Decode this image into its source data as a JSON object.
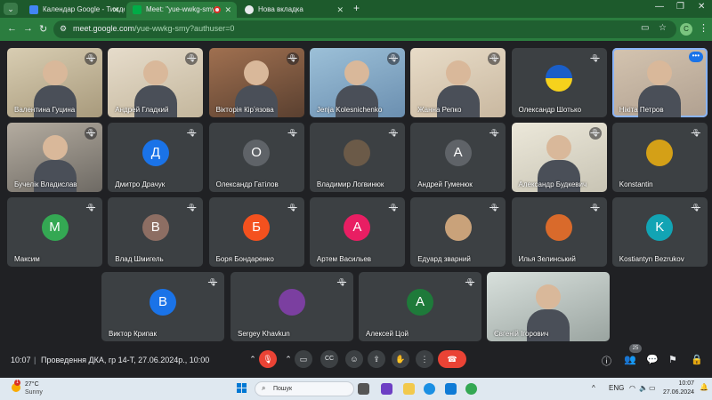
{
  "browser": {
    "tabs": [
      {
        "label": "Календар Google - Тиждень (2",
        "active": false
      },
      {
        "label": "Meet: \"yue-wwkg-smy\"",
        "active": true
      },
      {
        "label": "Нова вкладка",
        "active": false
      }
    ],
    "url_host": "meet.google.com",
    "url_path": "/yue-wwkg-smy?authuser=0",
    "profile_initial": "C"
  },
  "participants": [
    {
      "name": "Валентина Гуцина",
      "type": "video",
      "mic": "muted"
    },
    {
      "name": "Андрей Гладкий",
      "type": "video",
      "mic": "muted"
    },
    {
      "name": "Вікторія Кірʼязова",
      "type": "video",
      "mic": "muted"
    },
    {
      "name": "Jenja Kolesnichenko",
      "type": "video",
      "mic": "muted"
    },
    {
      "name": "Жанна Репко",
      "type": "video",
      "mic": "muted"
    },
    {
      "name": "Олександр Шотько",
      "type": "image",
      "mic": "muted"
    },
    {
      "name": "Нікіта Петров",
      "type": "video",
      "mic": "more",
      "more_label": "•••"
    },
    {
      "name": "Бучелік Владислав",
      "type": "video",
      "mic": "muted"
    },
    {
      "name": "Дмитро Драчук",
      "type": "avatar",
      "initial": "Д",
      "color": "#1a73e8",
      "mic": "muted"
    },
    {
      "name": "Олександр Гатілов",
      "type": "avatar",
      "initial": "О",
      "color": "#5f6368",
      "mic": "muted"
    },
    {
      "name": "Владимир Логвинюк",
      "type": "photo",
      "color": "#6b5a48",
      "mic": "muted"
    },
    {
      "name": "Андрей Гуменюк",
      "type": "avatar",
      "initial": "А",
      "color": "#5f6368",
      "mic": "muted"
    },
    {
      "name": "Александр Будкевич",
      "type": "video",
      "mic": "muted"
    },
    {
      "name": "Konstantin",
      "type": "photo",
      "color": "#d4a017",
      "mic": "muted"
    },
    {
      "name": "Максим",
      "type": "avatar",
      "initial": "М",
      "color": "#34a853",
      "mic": "muted"
    },
    {
      "name": "Влад Шмигель",
      "type": "avatar",
      "initial": "В",
      "color": "#8d6e63",
      "mic": "muted"
    },
    {
      "name": "Боря Бондаренко",
      "type": "avatar",
      "initial": "Б",
      "color": "#f4511e",
      "mic": "muted"
    },
    {
      "name": "Артем Васильев",
      "type": "avatar",
      "initial": "А",
      "color": "#e91e63",
      "mic": "muted"
    },
    {
      "name": "Едуард зварний",
      "type": "photo",
      "color": "#c9a27a",
      "mic": "muted"
    },
    {
      "name": "Илья Зелинський",
      "type": "photo",
      "color": "#d96a2b",
      "mic": "muted"
    },
    {
      "name": "Kostiantyn Bezrukov",
      "type": "avatar",
      "initial": "K",
      "color": "#12a4b4",
      "mic": "muted"
    },
    {
      "name": "Виктор Крипак",
      "type": "avatar",
      "initial": "B",
      "color": "#1a73e8",
      "mic": "muted"
    },
    {
      "name": "Sergey Khavkun",
      "type": "photo",
      "color": "#7b3fa0",
      "mic": "muted"
    },
    {
      "name": "Алексей Цой",
      "type": "avatar",
      "initial": "А",
      "color": "#1e7a3a",
      "mic": "muted"
    },
    {
      "name": "Євгеній Ігорович",
      "type": "video",
      "mic": "none"
    }
  ],
  "bottom_bar": {
    "time": "10:07",
    "separator": "|",
    "meeting_title": "Проведення ДКА, гр 14-Т, 27.06.2024р., 10:00",
    "cc_label": "CC",
    "people_count": "25"
  },
  "taskbar": {
    "notification_count": "1",
    "temperature": "27°C",
    "condition": "Sunny",
    "search_placeholder": "Пошук",
    "lang": "ENG",
    "clock_time": "10:07",
    "clock_date": "27.06.2024"
  },
  "colors": {
    "browser_frame": "#2b7d3f",
    "meet_bg": "#202124",
    "tile_bg": "#3c4043",
    "end_call": "#ea4335",
    "accent_blue": "#1a73e8"
  }
}
